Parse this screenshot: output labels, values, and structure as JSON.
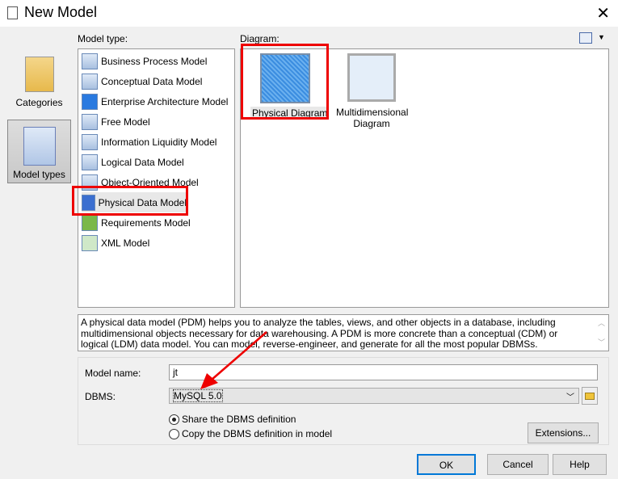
{
  "window": {
    "title": "New Model"
  },
  "sidebar": {
    "items": [
      {
        "label": "Categories",
        "selected": false
      },
      {
        "label": "Model types",
        "selected": true
      }
    ]
  },
  "model_type": {
    "label": "Model type:",
    "items": [
      "Business Process Model",
      "Conceptual Data Model",
      "Enterprise Architecture Model",
      "Free Model",
      "Information Liquidity Model",
      "Logical Data Model",
      "Object-Oriented Model",
      "Physical Data Model",
      "Requirements Model",
      "XML Model"
    ],
    "selected": "Physical Data Model"
  },
  "diagram": {
    "label": "Diagram:",
    "items": [
      "Physical Diagram",
      "Multidimensional Diagram"
    ],
    "selected": "Physical Diagram"
  },
  "description": "A physical data model (PDM) helps you to analyze the tables, views, and other objects in a database, including multidimensional objects necessary for data warehousing. A PDM is more concrete than a conceptual (CDM) or logical (LDM) data model. You can model, reverse-engineer, and generate for all the most popular DBMSs.",
  "form": {
    "model_name_label": "Model name:",
    "model_name_value": "jt",
    "dbms_label": "DBMS:",
    "dbms_value": "MySQL 5.0",
    "share_label": "Share the DBMS definition",
    "copy_label": "Copy the DBMS definition in model",
    "share_selected": true,
    "extensions_label": "Extensions..."
  },
  "buttons": {
    "ok": "OK",
    "cancel": "Cancel",
    "help": "Help"
  },
  "colors": {
    "annotation": "#e00000",
    "selection": "#cce8ff"
  }
}
